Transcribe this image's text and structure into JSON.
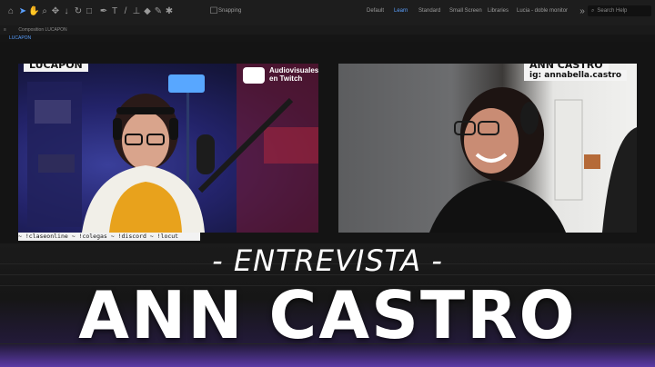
{
  "toolbar": {
    "workspaces": [
      "Default",
      "Learn",
      "Standard",
      "Small Screen",
      "Libraries",
      "Lucia - doble monitor"
    ],
    "active_workspace": "Learn",
    "snapping_label": "Snapping",
    "search_placeholder": "Search Help"
  },
  "composition": {
    "tab_label": "Composition LUCAPON",
    "sub_tab": "LUCAPON"
  },
  "left_panel": {
    "name": "LUCAPON",
    "badge_text": "Audiovisuales\nen Twitch",
    "ticker": "~ !claseonline ~ !colegas ~ !discord ~ !locut"
  },
  "right_panel": {
    "name": "ANN CASTRO",
    "handle": "ig: annabella.castro"
  },
  "overlay": {
    "subtitle": "- ENTREVISTA -",
    "headline": "ANN CASTRO"
  },
  "colors": {
    "accent_blue": "#5aa0ff",
    "glow_purple": "#5b3aa6"
  }
}
